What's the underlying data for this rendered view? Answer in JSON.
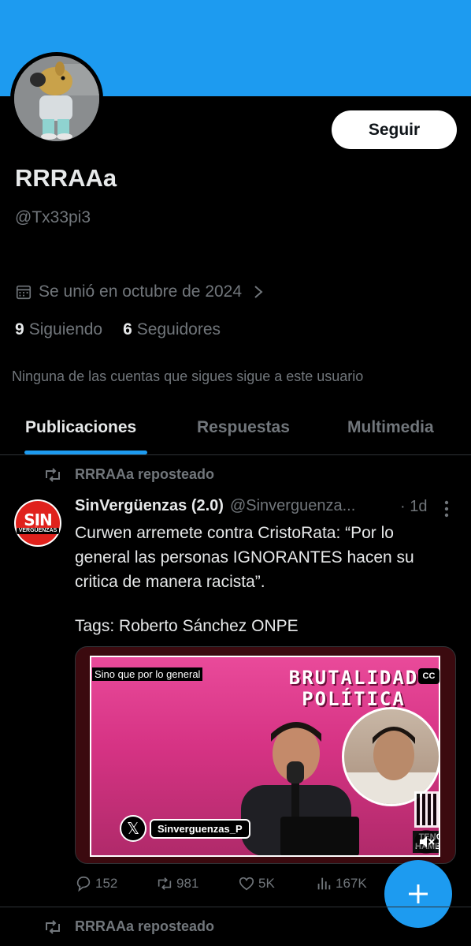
{
  "profile": {
    "display_name": "RRRAAa",
    "handle": "@Tx33pi3",
    "joined": "Se unió en octubre de 2024",
    "following_count": "9",
    "following_label": "Siguiendo",
    "followers_count": "6",
    "followers_label": "Seguidores",
    "mutual_note": "Ninguna de las cuentas que sigues sigue a este usuario",
    "follow_label": "Seguir"
  },
  "tabs": [
    {
      "label": "Publicaciones",
      "active": true
    },
    {
      "label": "Respuestas",
      "active": false
    },
    {
      "label": "Multimedia",
      "active": false
    }
  ],
  "posts": [
    {
      "repost_label": "RRRAAa reposteado",
      "author": "SinVergüenzas (2.0)",
      "handle": "@Sinverguenza...",
      "time": "· 1d",
      "avatar_text_top": "SIN",
      "avatar_text_bottom": "VERGÜENZAS",
      "text": "Curwen arremete contra CristoRata: “Por lo general las personas IGNORANTES hacen su critica de manera racista”.",
      "tags": "Tags: Roberto Sánchez ONPE",
      "media": {
        "caption": "Sino que por lo general",
        "headline_line1": "BRUTALIDAD",
        "headline_line2": "POLÍTICA",
        "cc": "CC",
        "x_handle": "Sinverguenzas_P",
        "corner_label": "TENGO HAMBRE"
      },
      "stats": {
        "replies": "152",
        "reposts": "981",
        "likes": "5K",
        "views": "167K"
      }
    },
    {
      "repost_label": "RRRAAa reposteado"
    }
  ],
  "colors": {
    "accent": "#1d9bf0",
    "background": "#000000",
    "secondary_text": "#71767b",
    "primary_text": "#e7e9ea"
  }
}
